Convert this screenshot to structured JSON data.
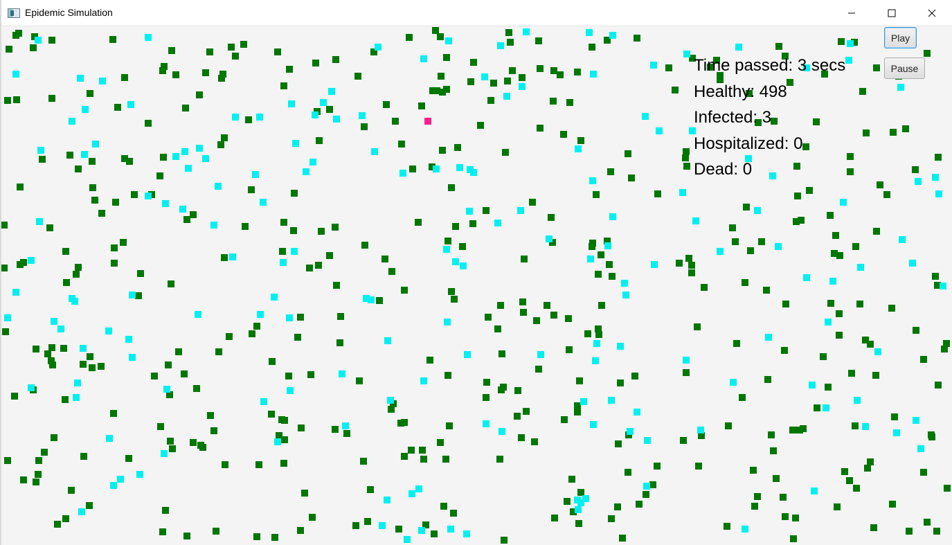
{
  "window": {
    "title": "Epidemic Simulation",
    "controls": {
      "minimize": "minimize-icon",
      "maximize": "maximize-icon",
      "close": "close-icon"
    }
  },
  "colors": {
    "healthy": "#007700",
    "moving": "#00f0f0",
    "infected": "#ff1f8c",
    "background": "#f4f4f4"
  },
  "stats": {
    "time_passed": "Time passed: 3 secs",
    "healthy": "Healthy: 498",
    "infected": "Infected: 3",
    "hospitalized": "Hospitalized: 0",
    "dead": "Dead: 0"
  },
  "buttons": {
    "play": "Play",
    "pause": "Pause"
  }
}
